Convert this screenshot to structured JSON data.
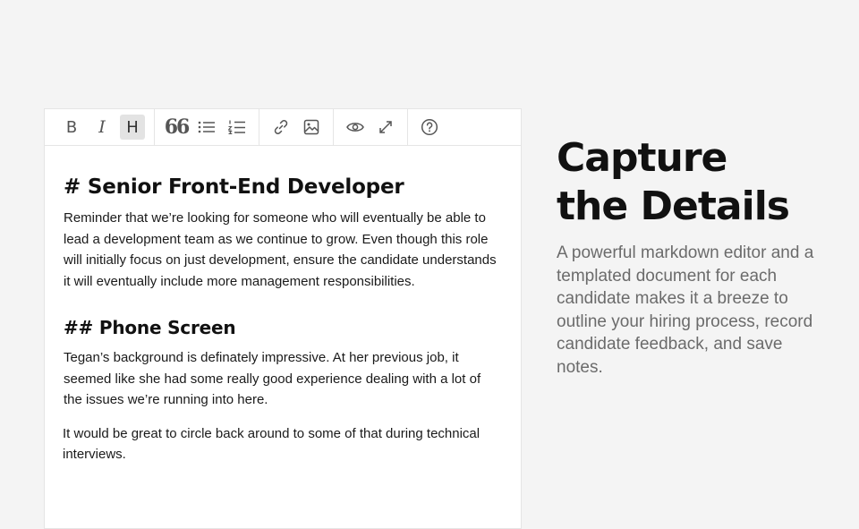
{
  "editor": {
    "toolbar": {
      "bold_label": "B",
      "italic_label": "I",
      "heading_label": "H",
      "quote_label": "66"
    },
    "content": {
      "h1": "# Senior Front-End Developer",
      "p1": "Reminder that we’re looking for someone who will eventually be able to lead a development team as we continue to grow. Even though this role will initially focus on just development, ensure the candidate understands it will eventually include more management responsibilities.",
      "h2": "## Phone Screen",
      "p2": "Tegan’s background is definately impressive. At her previous job, it seemed like she had some really good experience dealing with a lot of the issues we’re running into here.",
      "p3": "It would be great to circle back around to some of that during technical interviews."
    }
  },
  "aside": {
    "headline_line1": "Capture",
    "headline_line2": "the Details",
    "description": "A powerful markdown editor and a templated document for each candidate makes it a breeze to outline your hiring process, record candidate feedback, and save notes."
  },
  "colors": {
    "background": "#f4f4f4",
    "editor_background": "#ffffff",
    "border": "#e5e5e5",
    "active_button": "#e3e3e3",
    "headline": "#111111",
    "subtext": "#6b6b6b"
  },
  "icons": [
    "bold-icon",
    "italic-icon",
    "heading-icon",
    "quote-icon",
    "unordered-list-icon",
    "ordered-list-icon",
    "link-icon",
    "image-icon",
    "preview-eye-icon",
    "fullscreen-icon",
    "help-icon"
  ]
}
